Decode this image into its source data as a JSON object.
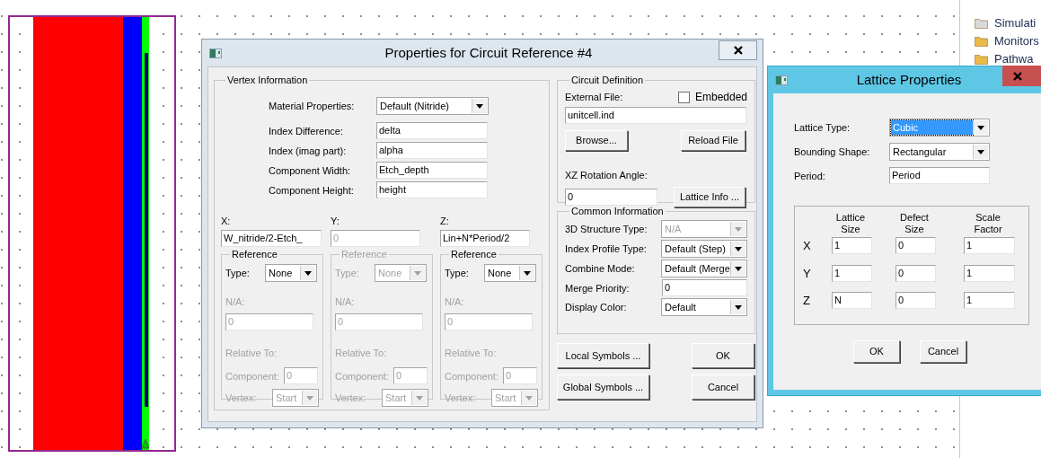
{
  "project_tree": {
    "items": [
      {
        "label": "Simulati",
        "color": "#d9d9d9"
      },
      {
        "label": "Monitors",
        "color": "#e9b949"
      },
      {
        "label": "Pathwa",
        "color": "#e9b949"
      }
    ]
  },
  "properties_dialog": {
    "title": "Properties for Circuit Reference #4",
    "vertex_information": {
      "title": "Vertex Information",
      "fields": [
        {
          "label": "Material Properties:",
          "value": "Default (Nitride)",
          "kind": "dropdown"
        },
        {
          "label": "Index Difference:",
          "value": "delta",
          "kind": "text"
        },
        {
          "label": "Index (imag part):",
          "value": "alpha",
          "kind": "text"
        },
        {
          "label": "Component Width:",
          "value": "Etch_depth",
          "kind": "text"
        },
        {
          "label": "Component Height:",
          "value": "height",
          "kind": "text"
        }
      ],
      "coordinates": [
        {
          "label": "X:",
          "value": "W_nitride/2-Etch_",
          "disabled": false,
          "reference": {
            "title": "Reference",
            "disabled": false,
            "type_label": "Type:",
            "type_value": "None",
            "na_label": "N/A:",
            "na_value": "0",
            "relative_label": "Relative To:",
            "component_label": "Component:",
            "component_value": "0",
            "vertex_label": "Vertex:",
            "vertex_value": "Start",
            "details_disabled": true
          }
        },
        {
          "label": "Y:",
          "value": "0",
          "disabled": true,
          "reference": {
            "title": "Reference",
            "disabled": true,
            "type_label": "Type:",
            "type_value": "None",
            "na_label": "N/A:",
            "na_value": "0",
            "relative_label": "Relative To:",
            "component_label": "Component:",
            "component_value": "0",
            "vertex_label": "Vertex:",
            "vertex_value": "Start",
            "details_disabled": true
          }
        },
        {
          "label": "Z:",
          "value": "Lin+N*Period/2",
          "disabled": false,
          "reference": {
            "title": "Reference",
            "disabled": false,
            "type_label": "Type:",
            "type_value": "None",
            "na_label": "N/A:",
            "na_value": "0",
            "relative_label": "Relative To:",
            "component_label": "Component:",
            "component_value": "0",
            "vertex_label": "Vertex:",
            "vertex_value": "Start",
            "details_disabled": true
          }
        }
      ]
    },
    "circuit_definition": {
      "title": "Circuit Definition",
      "external_file_label": "External File:",
      "embedded": {
        "label": "Embedded",
        "checked": false
      },
      "external_file_value": "unitcell.ind",
      "browse_button": "Browse...",
      "reload_button": "Reload File",
      "rotation_label": "XZ Rotation Angle:",
      "rotation_value": "0",
      "lattice_button": "Lattice Info ..."
    },
    "common_information": {
      "title": "Common Information",
      "fields": [
        {
          "label": "3D Structure Type:",
          "value": "N/A",
          "kind": "dropdown",
          "disabled": true
        },
        {
          "label": "Index Profile Type:",
          "value": "Default (Step)",
          "kind": "dropdown",
          "disabled": false
        },
        {
          "label": "Combine Mode:",
          "value": "Default (Merge",
          "kind": "dropdown",
          "disabled": false
        },
        {
          "label": "Merge Priority:",
          "value": "0",
          "kind": "text",
          "disabled": false
        },
        {
          "label": "Display Color:",
          "value": "Default",
          "kind": "dropdown",
          "disabled": false
        }
      ]
    },
    "buttons": [
      "Local Symbols ...",
      "OK",
      "Global Symbols ...",
      "Cancel"
    ]
  },
  "lattice_dialog": {
    "title": "Lattice Properties",
    "fields": [
      {
        "label": "Lattice Type:",
        "value": "Cubic",
        "kind": "dropdown",
        "selected": true
      },
      {
        "label": "Bounding Shape:",
        "value": "Rectangular",
        "kind": "dropdown",
        "selected": false
      },
      {
        "label": "Period:",
        "value": "Period",
        "kind": "text",
        "selected": false
      }
    ],
    "table": {
      "columns": [
        "Lattice Size",
        "Defect Size",
        "Scale Factor"
      ],
      "rows": [
        {
          "axis": "X",
          "values": [
            "1",
            "0",
            "1"
          ]
        },
        {
          "axis": "Y",
          "values": [
            "1",
            "0",
            "1"
          ]
        },
        {
          "axis": "Z",
          "values": [
            "N",
            "0",
            "1"
          ]
        }
      ]
    },
    "buttons": [
      "OK",
      "Cancel"
    ]
  }
}
